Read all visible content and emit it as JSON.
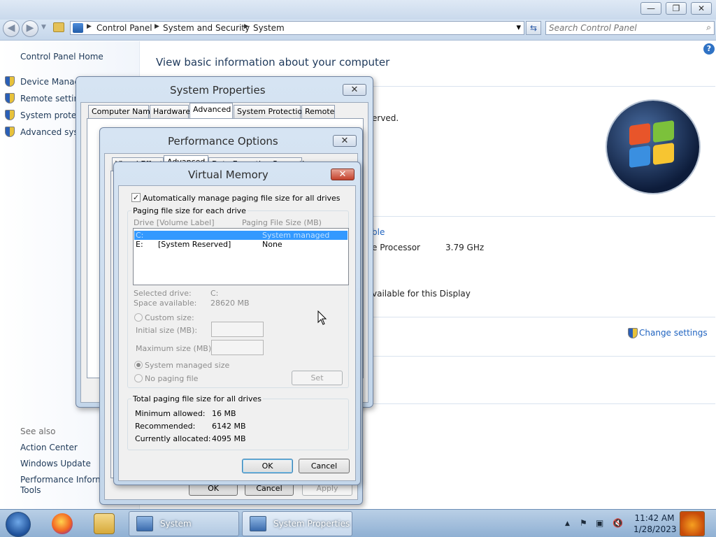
{
  "window": {
    "minimize_glyph": "—",
    "restore_glyph": "❐",
    "close_glyph": "✕"
  },
  "address": {
    "crumbs": [
      "Control Panel",
      "System and Security",
      "System"
    ],
    "separator": "▶",
    "dropdown_glyph": "▾",
    "refresh_glyph": "⇆"
  },
  "search": {
    "placeholder": "Search Control Panel",
    "icon": "search-icon"
  },
  "leftpane": {
    "home": "Control Panel Home",
    "links": [
      "Device Manager",
      "Remote settings",
      "System protection",
      "Advanced system settings"
    ],
    "see_also_title": "See also",
    "see_also": [
      "Action Center",
      "Windows Update",
      "Performance Information and",
      "Tools"
    ]
  },
  "main": {
    "heading": "View basic information about your computer",
    "reserved_text": "erved.",
    "rating_fragment": "ble",
    "processor_fragment": "e Processor",
    "processor_speed": "3.79 GHz",
    "display_fragment": "vailable for this Display",
    "change_settings": "Change settings",
    "help_glyph": "?"
  },
  "system_properties": {
    "title": "System Properties",
    "close_glyph": "✕",
    "tabs": [
      "Computer Name",
      "Hardware",
      "Advanced",
      "System Protection",
      "Remote"
    ],
    "active_tab": "Advanced"
  },
  "performance_options": {
    "title": "Performance Options",
    "close_glyph": "✕",
    "tabs": [
      "Visual Effects",
      "Advanced",
      "Data Execution Prevention"
    ],
    "ok": "OK",
    "cancel": "Cancel",
    "apply": "Apply"
  },
  "virtual_memory": {
    "title": "Virtual Memory",
    "close_glyph": "✕",
    "auto_manage_label": "Automatically manage paging file size for all drives",
    "auto_manage_checked": true,
    "group_each_drive": "Paging file size for each drive",
    "col_drive": "Drive  [Volume Label]",
    "col_size": "Paging File Size (MB)",
    "drives": [
      {
        "drive": "C:",
        "label": "",
        "size": "System managed"
      },
      {
        "drive": "E:",
        "label": "[System Reserved]",
        "size": "None"
      }
    ],
    "selected_drive_label": "Selected drive:",
    "selected_drive_value": "C:",
    "space_available_label": "Space available:",
    "space_available_value": "28620 MB",
    "custom_size": "Custom size:",
    "initial_size": "Initial size (MB):",
    "maximum_size": "Maximum size (MB):",
    "system_managed": "System managed size",
    "no_paging": "No paging file",
    "set": "Set",
    "group_total": "Total paging file size for all drives",
    "min_allowed_label": "Minimum allowed:",
    "min_allowed_value": "16 MB",
    "recommended_label": "Recommended:",
    "recommended_value": "6142 MB",
    "allocated_label": "Currently allocated:",
    "allocated_value": "4095 MB",
    "ok": "OK",
    "cancel": "Cancel"
  },
  "taskbar": {
    "tasks": [
      "System",
      "System Properties"
    ],
    "clock_time": "11:42 AM",
    "clock_date": "1/28/2023",
    "tray_icons": [
      "show-hidden-icon",
      "flag-icon",
      "network-icon",
      "volume-muted-icon"
    ],
    "tray_glyphs": [
      "▲",
      "⚑",
      "▣",
      "🔇"
    ]
  }
}
